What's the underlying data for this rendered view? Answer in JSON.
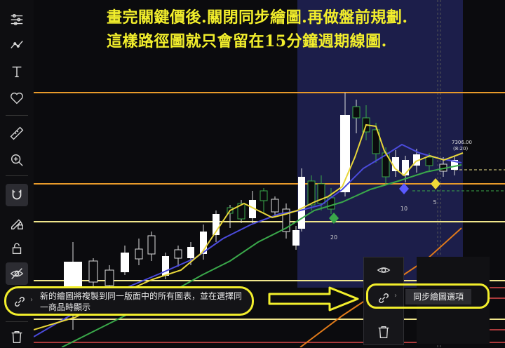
{
  "caption": {
    "line1": "畫完關鍵價後.關閉同步繪圖.再做盤前規劃.",
    "line2": "這樣路徑圖就只會留在15分鐘週期線圖."
  },
  "chart_labels": {
    "price_label": "7306.00",
    "price_time": "(8:20)",
    "marker_20": "20",
    "marker_10": "10",
    "marker_5": "5"
  },
  "tooltip": {
    "text": "新的繪圖將複製到同一版面中的所有圖表，並在選擇同一商品時顯示"
  },
  "sync_menu": {
    "label": "同步繪圖選項"
  },
  "toolbar": {
    "icons": [
      "crosshair-lines-icon",
      "trend-line-icon",
      "text-icon",
      "heart-icon",
      "ruler-icon",
      "zoom-in-icon",
      "magnet-icon",
      "lock-pencil-icon",
      "lock-icon",
      "eye-hidden-icon",
      "link-icon",
      "trash-icon"
    ]
  },
  "colors": {
    "caption": "#f2ee2c",
    "highlight_ring": "#f2ee2c",
    "session_band": "#1c1e4a",
    "orange_level": "#e89a2a",
    "yellow_level": "#f0e68c",
    "ma_blue": "#4b4bdc",
    "ma_green": "#3aa84a",
    "ma_yellow": "#e8d63a"
  }
}
